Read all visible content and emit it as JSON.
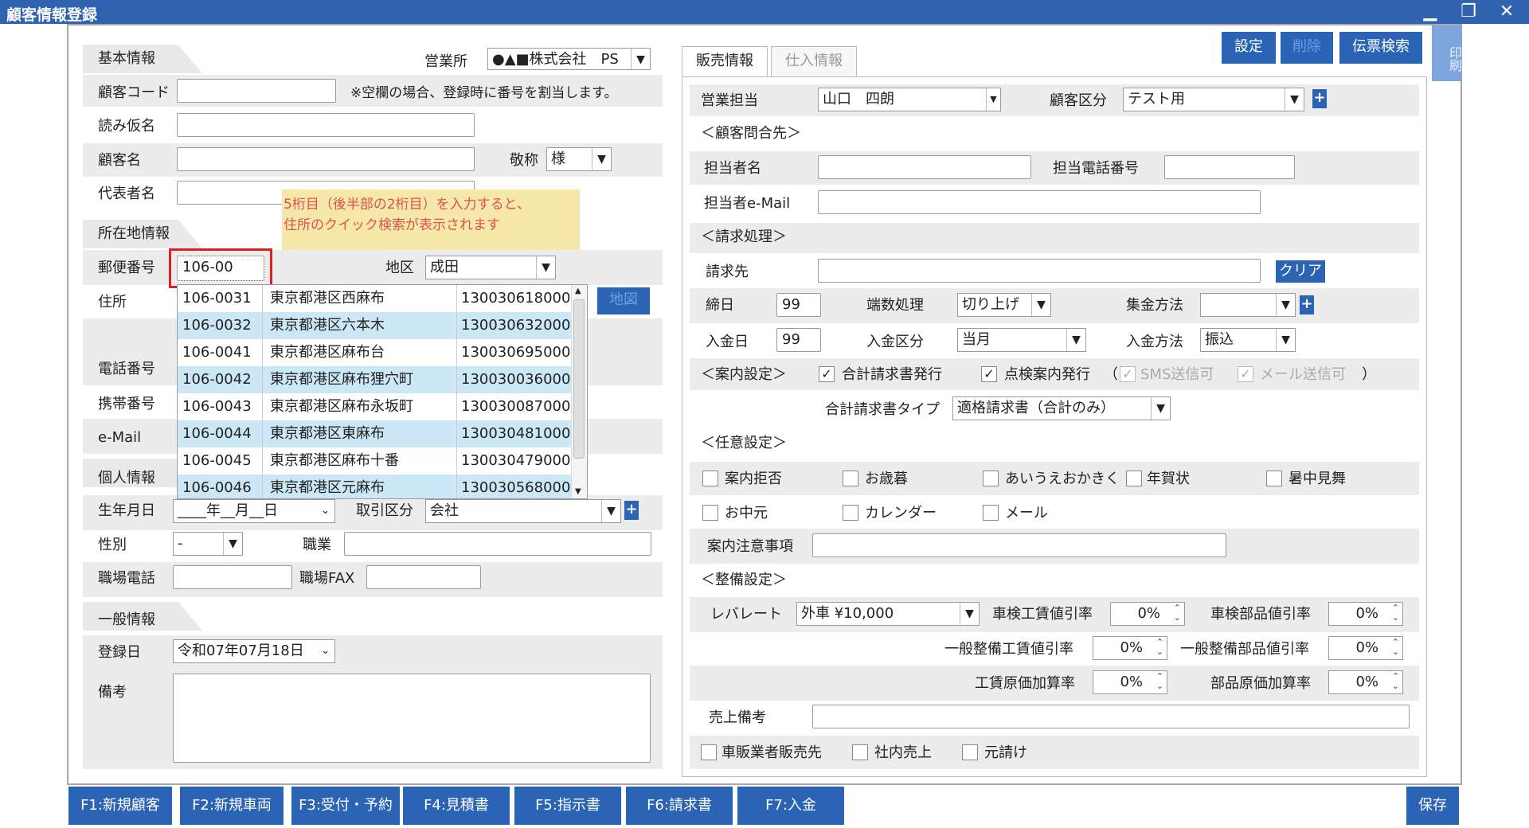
{
  "window": {
    "title": "顧客情報登録",
    "minimize": "▁",
    "restore": "❐",
    "close": "✕"
  },
  "left": {
    "basic_title": "基本情報",
    "office_label": "営業所",
    "office_value": "●▲■株式会社　PS",
    "customer_code_label": "顧客コード",
    "customer_code_note": "※空欄の場合、登録時に番号を割当します。",
    "kana_label": "読み仮名",
    "name_label": "顧客名",
    "honorific_label": "敬称",
    "honorific_value": "様",
    "rep_label": "代表者名",
    "tooltip_line1": "5桁目（後半部の2桁目）を入力すると、",
    "tooltip_line2": "住所のクイック検索が表示されます",
    "location_title": "所在地情報",
    "postal_label": "郵便番号",
    "postal_value": "106-00",
    "region_label": "地区",
    "region_value": "成田",
    "address_label": "住所",
    "map_button": "地図",
    "phone_label": "電話番号",
    "mobile_label": "携帯番号",
    "email_label": "e-Mail",
    "personal_title": "個人情報",
    "birthday_label": "生年月日",
    "birthday_value": "____年__月__日",
    "trade_label": "取引区分",
    "trade_value": "会社",
    "gender_label": "性別",
    "gender_value": "-",
    "job_label": "職業",
    "work_phone_label": "職場電話",
    "work_fax_label": "職場FAX",
    "general_title": "一般情報",
    "reg_date_label": "登録日",
    "reg_date_value": "令和07年07月18日",
    "notes_label": "備考",
    "suggestions": [
      {
        "zip": "106-0031",
        "addr": "東京都港区西麻布",
        "code": "130030618000"
      },
      {
        "zip": "106-0032",
        "addr": "東京都港区六本木",
        "code": "130030632000"
      },
      {
        "zip": "106-0041",
        "addr": "東京都港区麻布台",
        "code": "130030695000"
      },
      {
        "zip": "106-0042",
        "addr": "東京都港区麻布狸穴町",
        "code": "130030036000"
      },
      {
        "zip": "106-0043",
        "addr": "東京都港区麻布永坂町",
        "code": "130030087000"
      },
      {
        "zip": "106-0044",
        "addr": "東京都港区東麻布",
        "code": "130030481000"
      },
      {
        "zip": "106-0045",
        "addr": "東京都港区麻布十番",
        "code": "130030479000"
      },
      {
        "zip": "106-0046",
        "addr": "東京都港区元麻布",
        "code": "130030568000"
      }
    ]
  },
  "toolbar": {
    "settings": "設定",
    "delete": "削除",
    "slip_search": "伝票検索",
    "print": "印刷"
  },
  "tabs": {
    "sales": "販売情報",
    "purchase": "仕入情報"
  },
  "right": {
    "staff_label": "営業担当",
    "staff_value": "山口　四朗",
    "cust_type_label": "顧客区分",
    "cust_type_value": "テスト用",
    "contact_section": "＜顧客問合先＞",
    "contact_name_label": "担当者名",
    "contact_phone_label": "担当電話番号",
    "contact_email_label": "担当者e-Mail",
    "billing_section": "＜請求処理＞",
    "bill_to_label": "請求先",
    "clear_button": "クリア",
    "closing_label": "締日",
    "closing_value": "99",
    "rounding_label": "端数処理",
    "rounding_value": "切り上げ",
    "collection_label": "集金方法",
    "payment_day_label": "入金日",
    "payment_day_value": "99",
    "payment_type_label": "入金区分",
    "payment_type_value": "当月",
    "payment_method_label": "入金方法",
    "payment_method_value": "振込",
    "guide_section": "＜案内設定＞",
    "guide_total_invoice": "合計請求書発行",
    "guide_inspection": "点検案内発行",
    "paren_open": "（",
    "sms": "SMS送信可",
    "mail_ok": "メール送信可",
    "paren_close": "）",
    "invoice_type_label": "合計請求書タイプ",
    "invoice_type_value": "適格請求書（合計のみ）",
    "optional_section": "＜任意設定＞",
    "opt_refuse": "案内拒否",
    "opt_oseibo": "お歳暮",
    "opt_aiueo": "あいうえおかきく",
    "opt_nenga": "年賀状",
    "opt_shochu": "暑中見舞",
    "opt_ochugen": "お中元",
    "opt_calendar": "カレンダー",
    "opt_mail": "メール",
    "notice_label": "案内注意事項",
    "maint_section": "＜整備設定＞",
    "labor_rate_label": "レバレート",
    "labor_rate_value": "外車 ¥10,000",
    "inspect_labor_disc_label": "車検工賃値引率",
    "inspect_labor_disc": "0%",
    "inspect_parts_disc_label": "車検部品値引率",
    "inspect_parts_disc": "0%",
    "gen_labor_disc_label": "一般整備工賃値引率",
    "gen_labor_disc": "0%",
    "gen_parts_disc_label": "一般整備部品値引率",
    "gen_parts_disc": "0%",
    "labor_markup_label": "工賃原価加算率",
    "labor_markup": "0%",
    "parts_markup_label": "部品原価加算率",
    "parts_markup": "0%",
    "sales_note_label": "売上備考",
    "dealer_sale": "車販業者販売先",
    "internal_sale": "社内売上",
    "subcontract": "元請け"
  },
  "fkeys": {
    "f1": "F1:新規顧客",
    "f2": "F2:新規車両",
    "f3": "F3:受付・予約",
    "f4": "F4:見積書",
    "f5": "F5:指示書",
    "f6": "F6:請求書",
    "f7": "F7:入金",
    "save": "保存"
  },
  "colors": {
    "accent": "#2b63b5",
    "title_bar": "#2f63b0",
    "tooltip_bg": "#f5e8a8",
    "tooltip_text": "#e05050",
    "highlight_row": "#cce8f6",
    "focus_border": "#e02020"
  }
}
